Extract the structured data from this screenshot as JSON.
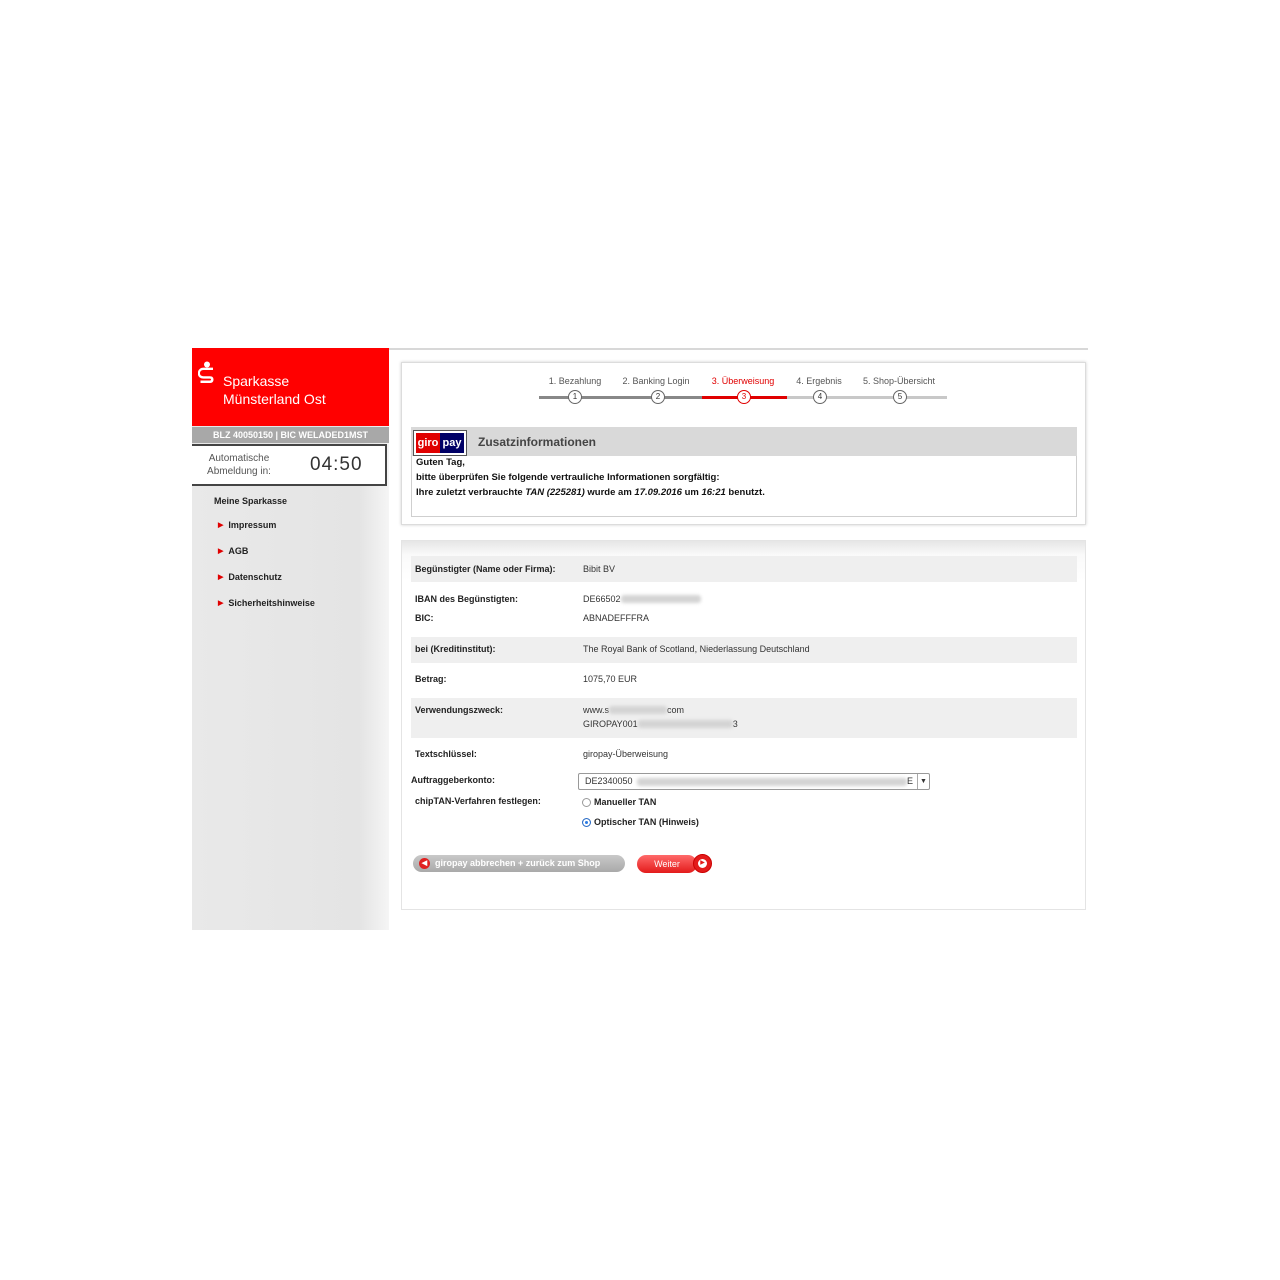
{
  "brand": {
    "name_line1": "Sparkasse",
    "name_line2": "Münsterland Ost",
    "color": "#ff0000",
    "logo_icon": "sparkasse-s-icon"
  },
  "sidebar": {
    "blz_bic": "BLZ 40050150 | BIC WELADED1MST",
    "logout_label": "Automatische Abmeldung in:",
    "logout_timer": "04:50",
    "nav_title": "Meine Sparkasse",
    "items": [
      {
        "label": "Impressum"
      },
      {
        "label": "AGB"
      },
      {
        "label": "Datenschutz"
      },
      {
        "label": "Sicherheitshinweise"
      }
    ]
  },
  "steps": [
    {
      "label": "1. Bezahlung",
      "num": "1"
    },
    {
      "label": "2. Banking Login",
      "num": "2"
    },
    {
      "label": "3. Überweisung",
      "num": "3"
    },
    {
      "label": "4. Ergebnis",
      "num": "4"
    },
    {
      "label": "5. Shop-Übersicht",
      "num": "5"
    }
  ],
  "active_step": 3,
  "info": {
    "logo_giro": "giro",
    "logo_pay": "pay",
    "title": "Zusatzinformationen",
    "greeting": "Guten Tag,",
    "line2": "bitte überprüfen Sie folgende vertrauliche Informationen sorgfältig:",
    "line3_prefix": "Ihre zuletzt verbrauchte ",
    "line3_tan": "TAN (225281)",
    "line3_mid": " wurde am ",
    "line3_date": "17.09.2016",
    "line3_um": " um ",
    "line3_time": "16:21",
    "line3_suffix": " benutzt."
  },
  "details": {
    "beneficiary_label": "Begünstigter (Name oder Firma):",
    "beneficiary_value": "Bibit BV",
    "iban_label": "IBAN des Begünstigten:",
    "iban_value_visible": "DE66502",
    "bic_label": "BIC:",
    "bic_value": "ABNADEFFFRA",
    "bank_label": "bei (Kreditinstitut):",
    "bank_value": "The Royal Bank of Scotland, Niederlassung Deutschland",
    "amount_label": "Betrag:",
    "amount_value": "1075,70 EUR",
    "purpose_label": "Verwendungszweck:",
    "purpose_line1_start": "www.s",
    "purpose_line1_end": "com",
    "purpose_line2_start": "GIROPAY001",
    "purpose_line2_end": "3",
    "key_label": "Textschlüssel:",
    "key_value": "giropay-Überweisung",
    "account_label": "Auftraggeberkonto:",
    "account_value_visible": "DE2340050",
    "account_value_end": "E",
    "tan_method_label": "chipTAN-Verfahren festlegen:",
    "tan_options": [
      {
        "label": "Manueller TAN",
        "checked": false
      },
      {
        "label": "Optischer TAN (Hinweis)",
        "checked": true
      }
    ]
  },
  "buttons": {
    "cancel": "giropay abbrechen + zurück zum Shop",
    "next": "Weiter"
  }
}
